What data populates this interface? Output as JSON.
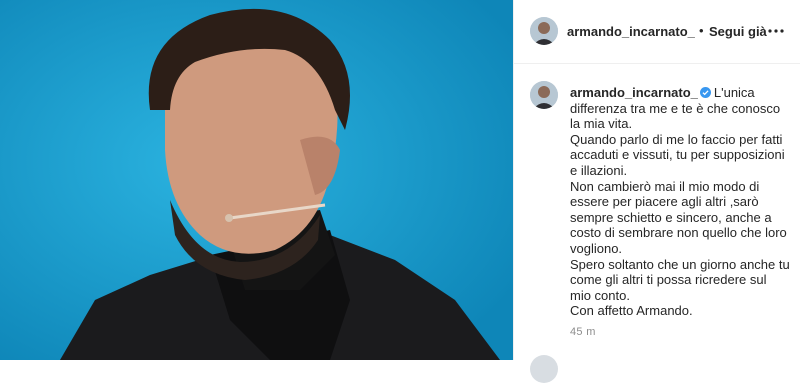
{
  "post": {
    "username": "armando_incarnato_",
    "separator": "•",
    "follow_label": "Segui già",
    "caption_lines": [
      "L'unica differenza tra me e te è che conosco la mia vita.",
      "Quando parlo di me lo faccio per fatti accaduti e vissuti, tu per supposizioni e illazioni.",
      "Non cambierò mai il mio modo di essere per piacere agli altri ,sarò sempre schietto e sincero, anche a costo di sembrare non quello che loro vogliono.",
      "Spero soltanto che un giorno anche tu come gli altri ti possa ricredere sul mio conto.",
      "Con affetto Armando."
    ],
    "time_ago": "45 m"
  },
  "icons": {
    "more": "more-horizontal-icon",
    "verified": "verified-badge-icon"
  },
  "colors": {
    "photo_background": "#1aa0cf",
    "verified_blue": "#3897f0",
    "text": "#262626",
    "muted": "#8e8e8e"
  }
}
